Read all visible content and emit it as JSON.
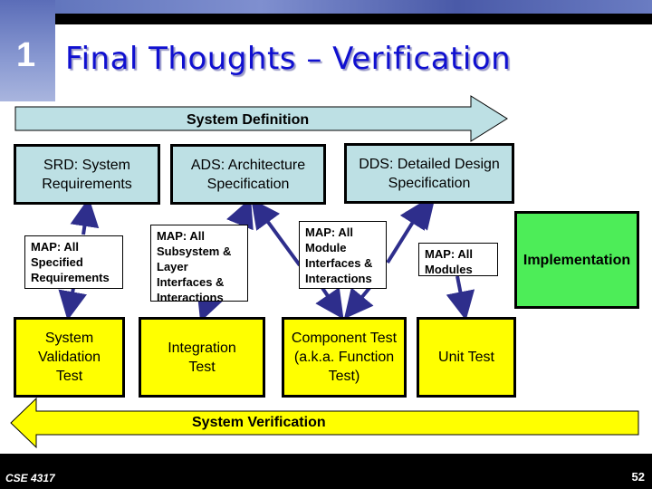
{
  "slide": {
    "section_number": "1",
    "title": "Final Thoughts – Verification",
    "footer_course": "CSE 4317",
    "page_number": "52"
  },
  "arrows": {
    "definition_label": "System Definition",
    "verification_label": "System Verification"
  },
  "specs": [
    {
      "label": "SRD: System Requirements"
    },
    {
      "label": "ADS: Architecture Specification"
    },
    {
      "label": "DDS: Detailed Design Specification"
    }
  ],
  "maps": [
    {
      "label": "MAP: All Specified Requirements"
    },
    {
      "label": "MAP: All Subsystem & Layer Interfaces & Interactions"
    },
    {
      "label": "MAP: All Module Interfaces & Interactions"
    },
    {
      "label": "MAP: All Modules"
    }
  ],
  "tests": [
    {
      "label": "System Validation Test"
    },
    {
      "label": "Integration Test"
    },
    {
      "label": "Component Test (a.k.a. Function Test)"
    },
    {
      "label": "Unit Test"
    }
  ],
  "implementation": {
    "label": "Implementation"
  },
  "colors": {
    "title": "#1010d0",
    "spec_fill": "#bde0e4",
    "test_fill": "#ffff00",
    "impl_fill": "#4ded58",
    "connector": "#2e2e8c"
  }
}
